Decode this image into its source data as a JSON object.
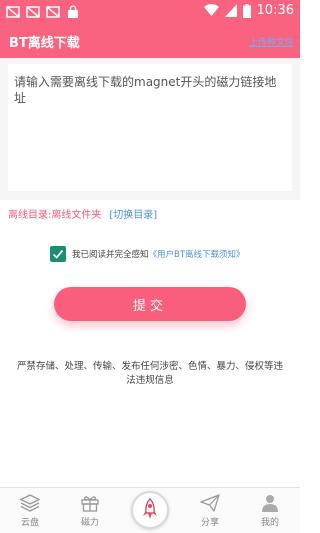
{
  "status_bar": {
    "time": "10:36",
    "icons": [
      "no-image-icon",
      "no-image-icon",
      "no-image-icon",
      "bag-icon",
      "wifi-icon",
      "sim-icon",
      "battery-icon"
    ]
  },
  "header": {
    "title": "BT离线下载",
    "upload_link": "上传种文件"
  },
  "input": {
    "placeholder": "请输入需要离线下载的magnet开头的磁力链接地址"
  },
  "directory": {
    "label": "离线目录:离线文件夹",
    "switch_label": "[切换目录]"
  },
  "agreement": {
    "checked": true,
    "text": "我已阅读并完全感知",
    "link": "《用户BT离线下载须知》"
  },
  "submit": {
    "label": "提交"
  },
  "notice": {
    "text": "严禁存储、处理、传输、发布任何涉密、色情、暴力、侵权等违法违规信息"
  },
  "tabs": [
    {
      "label": "云盘",
      "icon": "layers-icon"
    },
    {
      "label": "磁力",
      "icon": "gift-icon"
    },
    {
      "label": "",
      "icon": "rocket-icon"
    },
    {
      "label": "分享",
      "icon": "paper-plane-icon"
    },
    {
      "label": "我的",
      "icon": "user-icon"
    }
  ],
  "colors": {
    "brand": "#f9637f",
    "link": "#4a8fe0",
    "checkbox": "#1e8c74"
  }
}
